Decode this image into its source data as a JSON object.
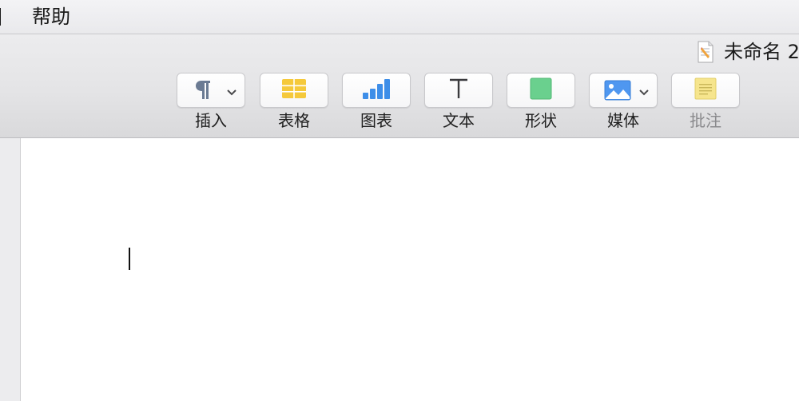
{
  "menubar": {
    "items": [
      {
        "label": "帮助"
      }
    ]
  },
  "window": {
    "title": "未命名 2"
  },
  "toolbar": {
    "buttons": [
      {
        "label": "插入",
        "icon": "paragraph-icon",
        "has_dropdown": true
      },
      {
        "label": "表格",
        "icon": "table-icon",
        "has_dropdown": false
      },
      {
        "label": "图表",
        "icon": "bar-chart-icon",
        "has_dropdown": false
      },
      {
        "label": "文本",
        "icon": "text-icon",
        "has_dropdown": false
      },
      {
        "label": "形状",
        "icon": "shape-icon",
        "has_dropdown": false
      },
      {
        "label": "媒体",
        "icon": "image-icon",
        "has_dropdown": true
      },
      {
        "label": "批注",
        "icon": "comment-note-icon",
        "has_dropdown": false,
        "enabled": false
      }
    ]
  },
  "colors": {
    "table_icon": "#f5c93b",
    "chart_icon": "#3e8ee8",
    "shape_icon": "#6ad08e",
    "media_icon": "#4f97f0",
    "comment_icon": "#f6e58d"
  }
}
